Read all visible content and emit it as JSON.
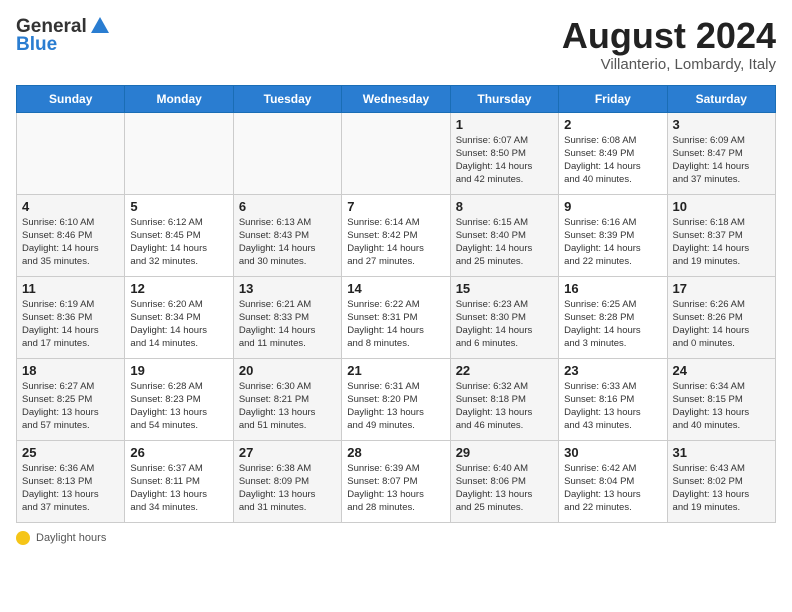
{
  "header": {
    "logo_line1": "General",
    "logo_line2": "Blue",
    "title": "August 2024",
    "subtitle": "Villanterio, Lombardy, Italy"
  },
  "days_of_week": [
    "Sunday",
    "Monday",
    "Tuesday",
    "Wednesday",
    "Thursday",
    "Friday",
    "Saturday"
  ],
  "weeks": [
    [
      {
        "day": "",
        "info": ""
      },
      {
        "day": "",
        "info": ""
      },
      {
        "day": "",
        "info": ""
      },
      {
        "day": "",
        "info": ""
      },
      {
        "day": "1",
        "info": "Sunrise: 6:07 AM\nSunset: 8:50 PM\nDaylight: 14 hours\nand 42 minutes."
      },
      {
        "day": "2",
        "info": "Sunrise: 6:08 AM\nSunset: 8:49 PM\nDaylight: 14 hours\nand 40 minutes."
      },
      {
        "day": "3",
        "info": "Sunrise: 6:09 AM\nSunset: 8:47 PM\nDaylight: 14 hours\nand 37 minutes."
      }
    ],
    [
      {
        "day": "4",
        "info": "Sunrise: 6:10 AM\nSunset: 8:46 PM\nDaylight: 14 hours\nand 35 minutes."
      },
      {
        "day": "5",
        "info": "Sunrise: 6:12 AM\nSunset: 8:45 PM\nDaylight: 14 hours\nand 32 minutes."
      },
      {
        "day": "6",
        "info": "Sunrise: 6:13 AM\nSunset: 8:43 PM\nDaylight: 14 hours\nand 30 minutes."
      },
      {
        "day": "7",
        "info": "Sunrise: 6:14 AM\nSunset: 8:42 PM\nDaylight: 14 hours\nand 27 minutes."
      },
      {
        "day": "8",
        "info": "Sunrise: 6:15 AM\nSunset: 8:40 PM\nDaylight: 14 hours\nand 25 minutes."
      },
      {
        "day": "9",
        "info": "Sunrise: 6:16 AM\nSunset: 8:39 PM\nDaylight: 14 hours\nand 22 minutes."
      },
      {
        "day": "10",
        "info": "Sunrise: 6:18 AM\nSunset: 8:37 PM\nDaylight: 14 hours\nand 19 minutes."
      }
    ],
    [
      {
        "day": "11",
        "info": "Sunrise: 6:19 AM\nSunset: 8:36 PM\nDaylight: 14 hours\nand 17 minutes."
      },
      {
        "day": "12",
        "info": "Sunrise: 6:20 AM\nSunset: 8:34 PM\nDaylight: 14 hours\nand 14 minutes."
      },
      {
        "day": "13",
        "info": "Sunrise: 6:21 AM\nSunset: 8:33 PM\nDaylight: 14 hours\nand 11 minutes."
      },
      {
        "day": "14",
        "info": "Sunrise: 6:22 AM\nSunset: 8:31 PM\nDaylight: 14 hours\nand 8 minutes."
      },
      {
        "day": "15",
        "info": "Sunrise: 6:23 AM\nSunset: 8:30 PM\nDaylight: 14 hours\nand 6 minutes."
      },
      {
        "day": "16",
        "info": "Sunrise: 6:25 AM\nSunset: 8:28 PM\nDaylight: 14 hours\nand 3 minutes."
      },
      {
        "day": "17",
        "info": "Sunrise: 6:26 AM\nSunset: 8:26 PM\nDaylight: 14 hours\nand 0 minutes."
      }
    ],
    [
      {
        "day": "18",
        "info": "Sunrise: 6:27 AM\nSunset: 8:25 PM\nDaylight: 13 hours\nand 57 minutes."
      },
      {
        "day": "19",
        "info": "Sunrise: 6:28 AM\nSunset: 8:23 PM\nDaylight: 13 hours\nand 54 minutes."
      },
      {
        "day": "20",
        "info": "Sunrise: 6:30 AM\nSunset: 8:21 PM\nDaylight: 13 hours\nand 51 minutes."
      },
      {
        "day": "21",
        "info": "Sunrise: 6:31 AM\nSunset: 8:20 PM\nDaylight: 13 hours\nand 49 minutes."
      },
      {
        "day": "22",
        "info": "Sunrise: 6:32 AM\nSunset: 8:18 PM\nDaylight: 13 hours\nand 46 minutes."
      },
      {
        "day": "23",
        "info": "Sunrise: 6:33 AM\nSunset: 8:16 PM\nDaylight: 13 hours\nand 43 minutes."
      },
      {
        "day": "24",
        "info": "Sunrise: 6:34 AM\nSunset: 8:15 PM\nDaylight: 13 hours\nand 40 minutes."
      }
    ],
    [
      {
        "day": "25",
        "info": "Sunrise: 6:36 AM\nSunset: 8:13 PM\nDaylight: 13 hours\nand 37 minutes."
      },
      {
        "day": "26",
        "info": "Sunrise: 6:37 AM\nSunset: 8:11 PM\nDaylight: 13 hours\nand 34 minutes."
      },
      {
        "day": "27",
        "info": "Sunrise: 6:38 AM\nSunset: 8:09 PM\nDaylight: 13 hours\nand 31 minutes."
      },
      {
        "day": "28",
        "info": "Sunrise: 6:39 AM\nSunset: 8:07 PM\nDaylight: 13 hours\nand 28 minutes."
      },
      {
        "day": "29",
        "info": "Sunrise: 6:40 AM\nSunset: 8:06 PM\nDaylight: 13 hours\nand 25 minutes."
      },
      {
        "day": "30",
        "info": "Sunrise: 6:42 AM\nSunset: 8:04 PM\nDaylight: 13 hours\nand 22 minutes."
      },
      {
        "day": "31",
        "info": "Sunrise: 6:43 AM\nSunset: 8:02 PM\nDaylight: 13 hours\nand 19 minutes."
      }
    ]
  ],
  "footer": {
    "label": "Daylight hours"
  }
}
